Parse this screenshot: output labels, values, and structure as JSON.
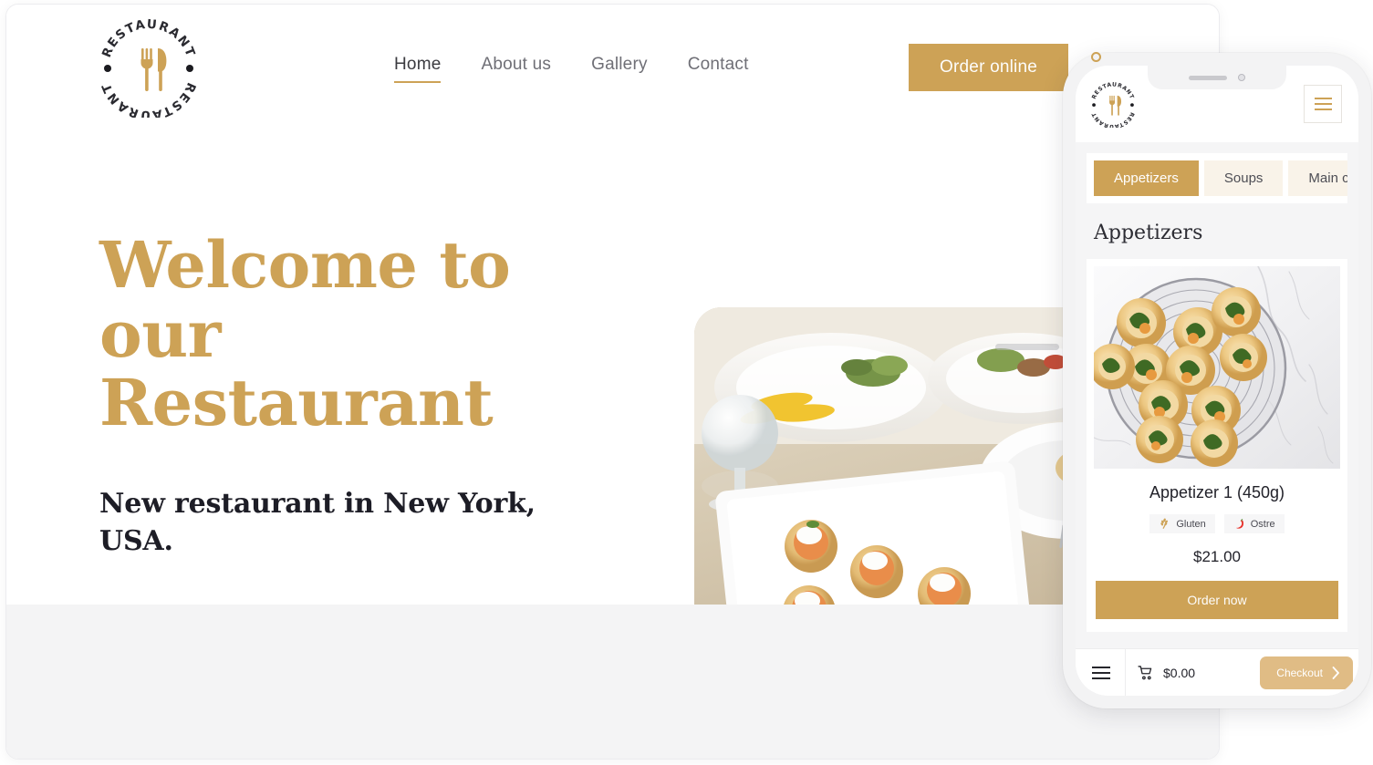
{
  "brand": {
    "logo_text_top": "RESTAURANT",
    "logo_text_bottom": "RESTAURANT",
    "logo_icon": "fork-knife-icon",
    "accent_gold": "#cda256",
    "accent_gold_light": "#e0bc85",
    "tab_inactive_bg": "#f9f3e9",
    "text_dark": "#1d1d26",
    "nav_text": "#6f6f76",
    "band_grey": "#f4f4f5"
  },
  "header": {
    "nav": [
      {
        "label": "Home",
        "active": true
      },
      {
        "label": "About us",
        "active": false
      },
      {
        "label": "Gallery",
        "active": false
      },
      {
        "label": "Contact",
        "active": false
      }
    ],
    "cta_label": "Order online"
  },
  "hero": {
    "title_line1": "Welcome to our",
    "title_line2": "Restaurant",
    "subtitle": "New restaurant in New York, USA.",
    "photo_alt": "plated canapes on a white rectangular dish on a restaurant table"
  },
  "phone": {
    "notch": {
      "speaker": "speaker-grille",
      "camera": "front-camera"
    },
    "topbar": {
      "logo_icon": "restaurant-logo-icon",
      "menu_icon": "hamburger-menu-icon"
    },
    "categories": [
      {
        "label": "Appetizers",
        "active": true
      },
      {
        "label": "Soups",
        "active": false
      },
      {
        "label": "Main cour",
        "active": false
      }
    ],
    "section_title": "Appetizers",
    "product": {
      "photo_alt": "spinach and cheese pinwheel pastries on a wire cooling rack over marble",
      "name": "Appetizer 1 (450g)",
      "badges": [
        {
          "label": "Gluten",
          "icon": "wheat-icon",
          "color": "#cda256"
        },
        {
          "label": "Ostre",
          "icon": "chili-pepper-icon",
          "color": "#e8302a"
        }
      ],
      "price": "$21.00",
      "order_label": "Order now"
    },
    "bottombar": {
      "menu_icon": "hamburger-menu-icon",
      "cart_icon": "shopping-cart-icon",
      "cart_total": "$0.00",
      "checkout_label": "Checkout",
      "checkout_chevron": "chevron-right-icon"
    }
  }
}
